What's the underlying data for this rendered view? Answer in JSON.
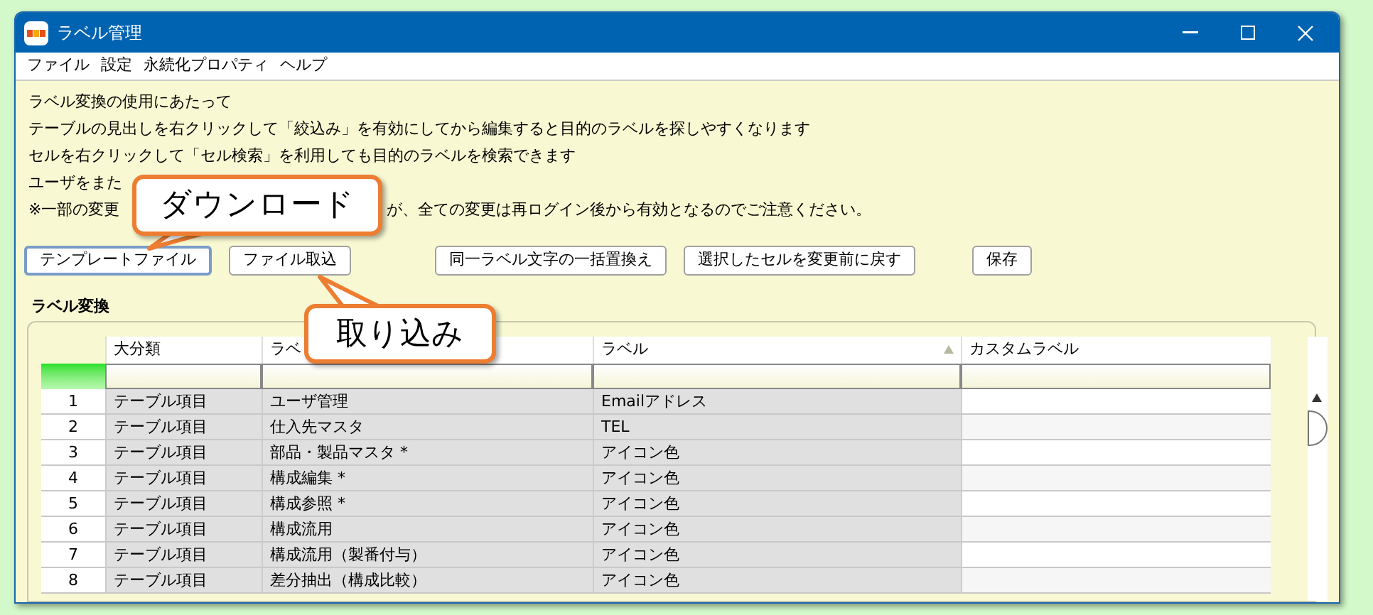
{
  "window": {
    "title": "ラベル管理"
  },
  "menu": [
    "ファイル",
    "設定",
    "永続化プロパティ",
    "ヘルプ"
  ],
  "notes": [
    [
      "ラベル変換の使用にあたって"
    ],
    [
      "テーブルの見出しを右クリックして「絞込み」を有効にしてから編集すると目的のラベルを探しやすくなります"
    ],
    [
      "セルを右クリックして「セル検索」を利用しても目的のラベルを検索できます"
    ],
    [
      "ユーザをまた"
    ],
    [
      "※一部の変更",
      "が、全ての変更は再ログイン後から有効となるのでご注意ください。"
    ]
  ],
  "buttons": [
    {
      "label": "テンプレートファイル",
      "focused": true
    },
    {
      "label": "ファイル取込",
      "focused": false
    },
    {
      "label": "同一ラベル文字の一括置換え",
      "focused": false
    },
    {
      "label": "選択したセルを変更前に戻す",
      "focused": false
    },
    {
      "label": "保存",
      "focused": false
    }
  ],
  "section_title": "ラベル変換",
  "table": {
    "columns": [
      {
        "label": "大分類",
        "sorted": false
      },
      {
        "label": "ラベ",
        "sorted": false
      },
      {
        "label": "ラベル",
        "sorted": true
      },
      {
        "label": "カスタムラベル",
        "sorted": false
      }
    ],
    "rows": [
      {
        "number": "1",
        "category": "テーブル項目",
        "name": "ユーザ管理",
        "label": "Emailアドレス"
      },
      {
        "number": "2",
        "category": "テーブル項目",
        "name": "仕入先マスタ",
        "label": "TEL"
      },
      {
        "number": "3",
        "category": "テーブル項目",
        "name": "部品・製品マスタ *",
        "label": "アイコン色"
      },
      {
        "number": "4",
        "category": "テーブル項目",
        "name": "構成編集 *",
        "label": "アイコン色"
      },
      {
        "number": "5",
        "category": "テーブル項目",
        "name": "構成参照 *",
        "label": "アイコン色"
      },
      {
        "number": "6",
        "category": "テーブル項目",
        "name": "構成流用",
        "label": "アイコン色"
      },
      {
        "number": "7",
        "category": "テーブル項目",
        "name": "構成流用（製番付与）",
        "label": "アイコン色"
      },
      {
        "number": "8",
        "category": "テーブル項目",
        "name": "差分抽出（構成比較）",
        "label": "アイコン色"
      }
    ]
  },
  "callouts": [
    {
      "text": "ダウンロード",
      "kind": "down"
    },
    {
      "text": "取り込み",
      "kind": "up"
    }
  ]
}
